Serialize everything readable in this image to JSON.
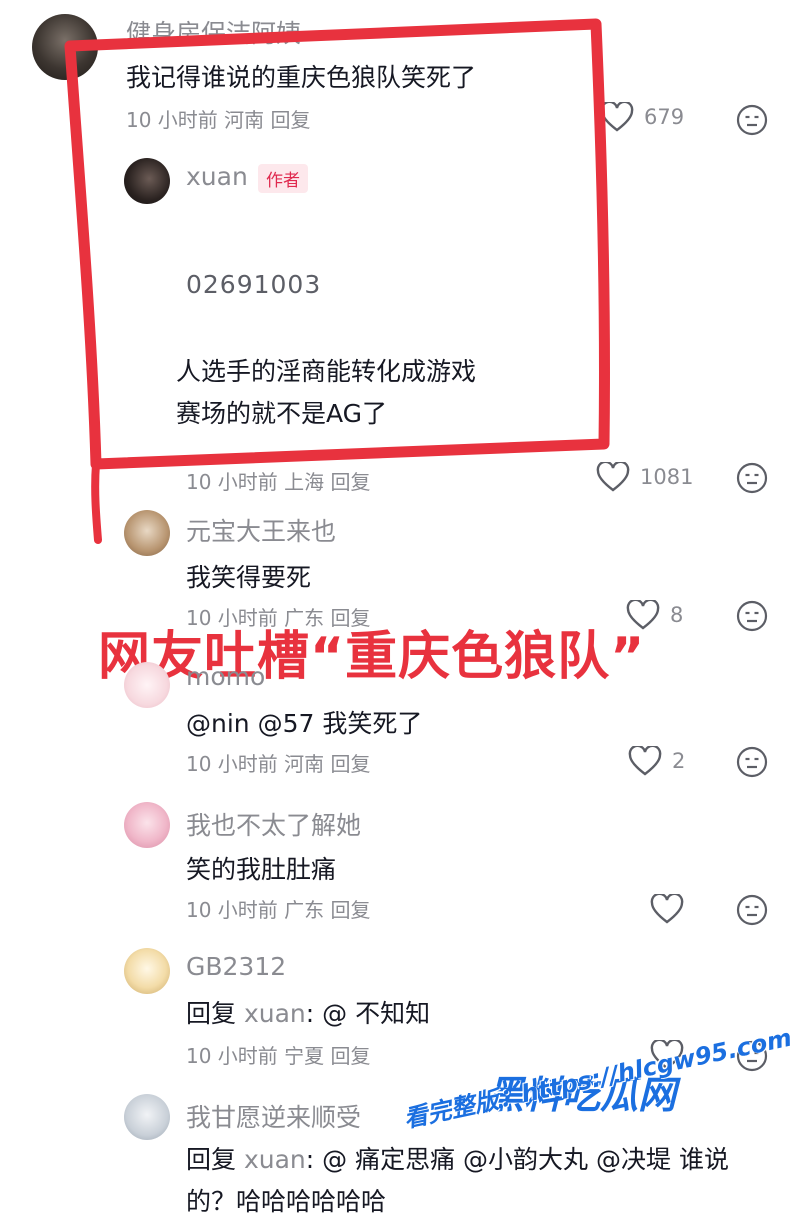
{
  "comments": [
    {
      "user": "健身房保洁阿姨",
      "text": "我记得谁说的重庆色狼队笑死了",
      "meta": "10 小时前 河南 回复",
      "likes": "679"
    },
    {
      "user": "xuan",
      "author_tag": "作者",
      "code": "02691003",
      "line1": "人选手的淫商能转化成游戏",
      "line2": "赛场的就不是AG了",
      "meta": "10 小时前 上海 回复",
      "likes": "1081"
    },
    {
      "user": "元宝大王来也",
      "text": "我笑得要死",
      "meta": "10 小时前 广东 回复",
      "likes": "8"
    },
    {
      "user": "momo",
      "text": "@nin @57 我笑死了",
      "meta": "10 小时前 河南 回复",
      "likes": "2"
    },
    {
      "user": "我也不太了解她",
      "text": "笑的我肚肚痛",
      "meta": "10 小时前 广东 回复",
      "likes": ""
    },
    {
      "user": "GB2312",
      "reply_prefix": "回复",
      "reply_to": "xuan",
      "text": ": @ 不知知",
      "meta": "10 小时前 宁夏 回复",
      "likes": ""
    },
    {
      "user": "我甘愿逆来顺受",
      "reply_prefix": "回复",
      "reply_to": "xuan",
      "text": ": @ 痛定思痛 @小韵大丸 @决堤 谁说",
      "text2": "的？哈哈哈哈哈哈",
      "meta": "",
      "likes": ""
    }
  ],
  "banner": "网友吐槽“重庆色狼队”",
  "watermark": {
    "brand": "黑料吃瓜网",
    "site": "看完整版：https://hlcgw95.com"
  },
  "colors": {
    "accent": "#e8323e",
    "muted": "#8a8b91",
    "link": "#1b6fe0"
  },
  "icons": {
    "like": "heart-outline-icon",
    "dislike": "meh-face-icon"
  }
}
